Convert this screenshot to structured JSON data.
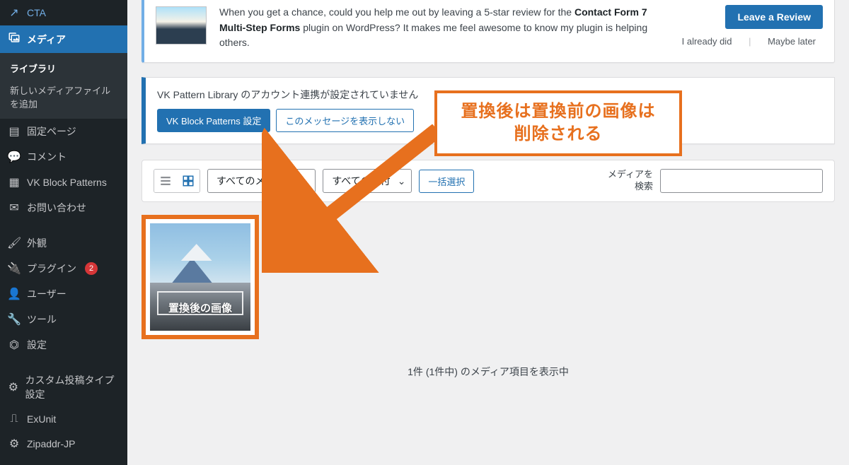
{
  "sidebar": {
    "items": [
      {
        "icon": "↗",
        "label": "CTA",
        "kind": "cta"
      },
      {
        "icon": "🖼",
        "label": "メディア",
        "kind": "media",
        "current": true
      },
      {
        "icon": "▤",
        "label": "固定ページ",
        "kind": "pages"
      },
      {
        "icon": "💬",
        "label": "コメント",
        "kind": "comments"
      },
      {
        "icon": "▦",
        "label": "VK Block Patterns",
        "kind": "vk-patterns"
      },
      {
        "icon": "✉",
        "label": "お問い合わせ",
        "kind": "contact"
      },
      {
        "icon": "🖌",
        "label": "外観",
        "kind": "appearance"
      },
      {
        "icon": "🔌",
        "label": "プラグイン",
        "kind": "plugins",
        "badge": "2"
      },
      {
        "icon": "👤",
        "label": "ユーザー",
        "kind": "users"
      },
      {
        "icon": "🔧",
        "label": "ツール",
        "kind": "tools"
      },
      {
        "icon": "⏣",
        "label": "設定",
        "kind": "settings"
      },
      {
        "icon": "⚙",
        "label": "カスタム投稿タイプ設定",
        "kind": "cpt-settings"
      },
      {
        "icon": "⎍",
        "label": "ExUnit",
        "kind": "exunit"
      },
      {
        "icon": "⚙",
        "label": "Zipaddr-JP",
        "kind": "zipaddr"
      }
    ],
    "media_sub": [
      {
        "label": "ライブラリ",
        "current": true
      },
      {
        "label": "新しいメディアファイルを追加",
        "current": false
      }
    ]
  },
  "review_notice": {
    "line1_pre": "When you get a chance, could you help me out by leaving a 5-star review for the ",
    "strong": "Contact Form 7 Multi-Step Forms",
    "line1_post": " plugin on WordPress? It makes me feel awesome to know my plugin is helping others.",
    "button": "Leave a Review",
    "link_already": "I already did",
    "link_later": "Maybe later"
  },
  "vk_notice": {
    "text": "VK Pattern Library のアカウント連携が設定されていません",
    "btn_primary": "VK Block Patterns 設定",
    "btn_secondary": "このメッセージを表示しない"
  },
  "filter": {
    "media_type": "すべてのメディア",
    "date": "すべての日付",
    "bulk_select": "一括選択",
    "search_label": "メディアを検索"
  },
  "media": {
    "items": [
      {
        "caption": "置換後の画像"
      }
    ],
    "status": "1件 (1件中) のメディア項目を表示中"
  },
  "annotation": {
    "line1": "置換後は置換前の画像は",
    "line2": "削除される"
  }
}
